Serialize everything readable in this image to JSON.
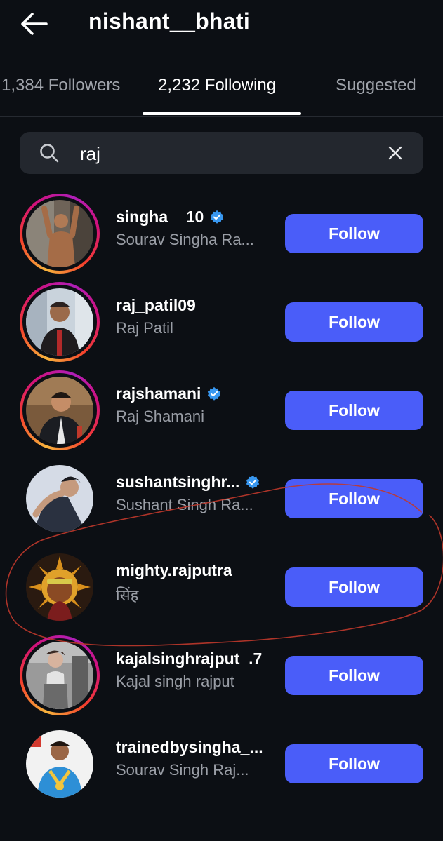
{
  "header": {
    "title": "nishant__bhati"
  },
  "tabs": [
    {
      "label": "1,384 Followers"
    },
    {
      "label": "2,232 Following"
    },
    {
      "label": "Suggested"
    }
  ],
  "search": {
    "value": "raj"
  },
  "users": [
    {
      "username": "singha__10",
      "fullname": "Sourav Singha Ra...",
      "verified": true,
      "follow_label": "Follow"
    },
    {
      "username": "raj_patil09",
      "fullname": "Raj Patil",
      "verified": false,
      "follow_label": "Follow"
    },
    {
      "username": "rajshamani",
      "fullname": "Raj Shamani",
      "verified": true,
      "follow_label": "Follow"
    },
    {
      "username": "sushantsinghr...",
      "fullname": "Sushant Singh Ra...",
      "verified": true,
      "follow_label": "Follow"
    },
    {
      "username": "mighty.rajputra",
      "fullname": "सिंह",
      "verified": false,
      "follow_label": "Follow"
    },
    {
      "username": "kajalsinghrajput_.7",
      "fullname": "Kajal singh rajput",
      "verified": false,
      "follow_label": "Follow"
    },
    {
      "username": "trainedbysingha_...",
      "fullname": "Sourav Singh Raj...",
      "verified": false,
      "follow_label": "Follow"
    }
  ],
  "colors": {
    "background": "#0c0f14",
    "follow_button": "#4a5df9",
    "verified_badge": "#3897f0",
    "search_bg": "#23272e",
    "scribble": "#c0392b"
  }
}
